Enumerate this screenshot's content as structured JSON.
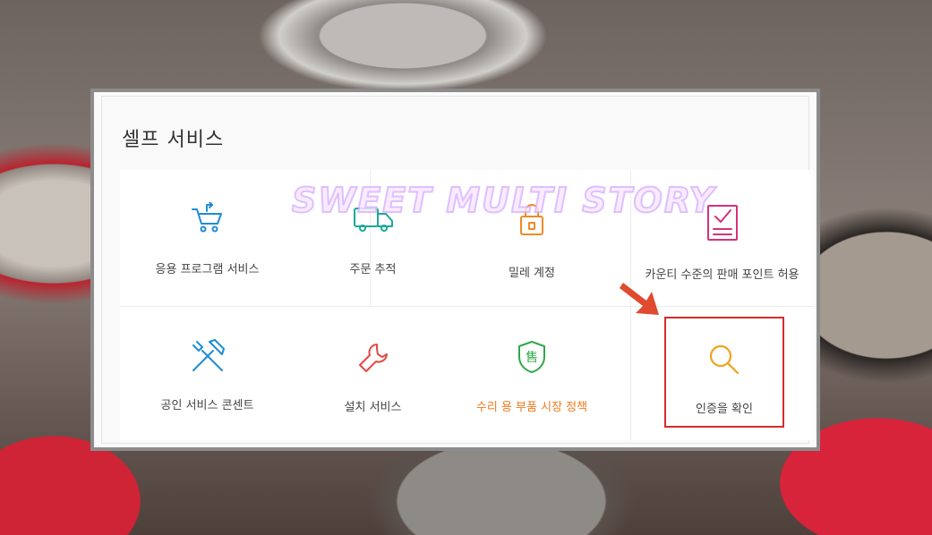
{
  "panel": {
    "title": "셀프 서비스",
    "items": [
      {
        "label": "응용 프로그램 서비스",
        "icon": "cart-return-icon",
        "color": "#1f8bd6"
      },
      {
        "label": "주문 추적",
        "icon": "delivery-truck-icon",
        "color": "#1aa99a"
      },
      {
        "label": "밀레 계정",
        "icon": "lock-icon",
        "color": "#f08a25"
      },
      {
        "label": "카운티 수준의 판매 포인트 허용",
        "icon": "checklist-icon",
        "color": "#d6307a"
      },
      {
        "label": "공인 서비스 콘센트",
        "icon": "tools-icon",
        "color": "#1f8bd6"
      },
      {
        "label": "설치 서비스",
        "icon": "wrench-icon",
        "color": "#e34a44"
      },
      {
        "label": "수리 용 부품 시장 정책",
        "icon": "shield-icon",
        "color": "#2ea84a",
        "label_color": "#f07a1e"
      },
      {
        "label": "인증을 확인",
        "icon": "search-icon",
        "color": "#f0a21c"
      }
    ],
    "shield_glyph": "售"
  },
  "watermark": {
    "text": "SWEET MULTI STORY"
  },
  "highlight_color": "#d52b2b"
}
